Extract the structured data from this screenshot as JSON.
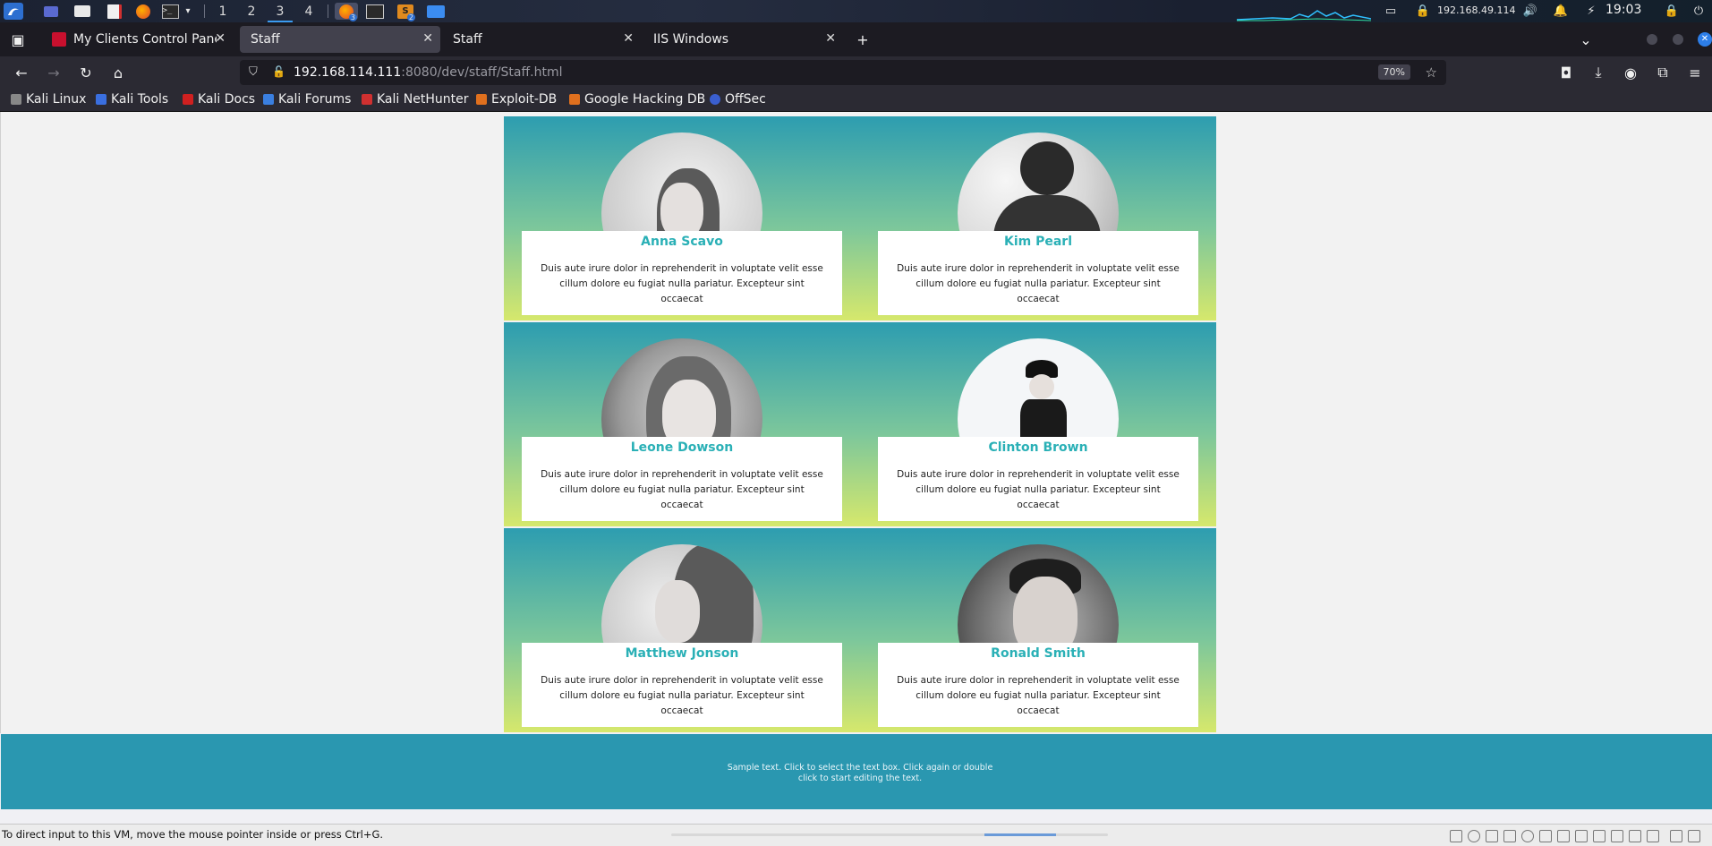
{
  "panel": {
    "workspaces": [
      "1",
      "2",
      "3",
      "4"
    ],
    "active_workspace": "3",
    "badge_firefox": "3",
    "badge_app": "2",
    "ip": "192.168.49.114",
    "time": "19:03"
  },
  "tabs": [
    {
      "label": "My Clients Control Panel",
      "favicon_color": "#c8102e",
      "active": false
    },
    {
      "label": "Staff",
      "active": true
    },
    {
      "label": "Staff",
      "active": false
    },
    {
      "label": "IIS Windows",
      "active": false
    }
  ],
  "navbar": {
    "url_host": "192.168.114.111",
    "url_path": ":8080/dev/staff/Staff.html",
    "zoom": "70%"
  },
  "bookmarks": [
    "Kali Linux",
    "Kali Tools",
    "Kali Docs",
    "Kali Forums",
    "Kali NetHunter",
    "Exploit-DB",
    "Google Hacking DB",
    "OffSec"
  ],
  "staff": [
    {
      "name": "Anna Scavo",
      "desc": "Duis aute irure dolor in reprehenderit in voluptate velit esse cillum dolore eu fugiat nulla pariatur. Excepteur sint occaecat"
    },
    {
      "name": "Kim Pearl",
      "desc": "Duis aute irure dolor in reprehenderit in voluptate velit esse cillum dolore eu fugiat nulla pariatur. Excepteur sint occaecat"
    },
    {
      "name": "Leone Dowson",
      "desc": "Duis aute irure dolor in reprehenderit in voluptate velit esse cillum dolore eu fugiat nulla pariatur. Excepteur sint occaecat"
    },
    {
      "name": "Clinton Brown",
      "desc": "Duis aute irure dolor in reprehenderit in voluptate velit esse cillum dolore eu fugiat nulla pariatur. Excepteur sint occaecat"
    },
    {
      "name": "Matthew Jonson",
      "desc": "Duis aute irure dolor in reprehenderit in voluptate velit esse cillum dolore eu fugiat nulla pariatur. Excepteur sint occaecat"
    },
    {
      "name": "Ronald Smith",
      "desc": "Duis aute irure dolor in reprehenderit in voluptate velit esse cillum dolore eu fugiat nulla pariatur. Excepteur sint occaecat"
    }
  ],
  "footer": {
    "text": "Sample text. Click to select the text box. Click again or double click to start editing the text."
  },
  "statusbar": {
    "text": "To direct input to this VM, move the mouse pointer inside or press Ctrl+G."
  },
  "colors": {
    "name_accent": "#2ab0b6",
    "footer_bg": "#2a97b0",
    "gradient_top": "#2d9db0",
    "gradient_bottom": "#d6e86c"
  }
}
